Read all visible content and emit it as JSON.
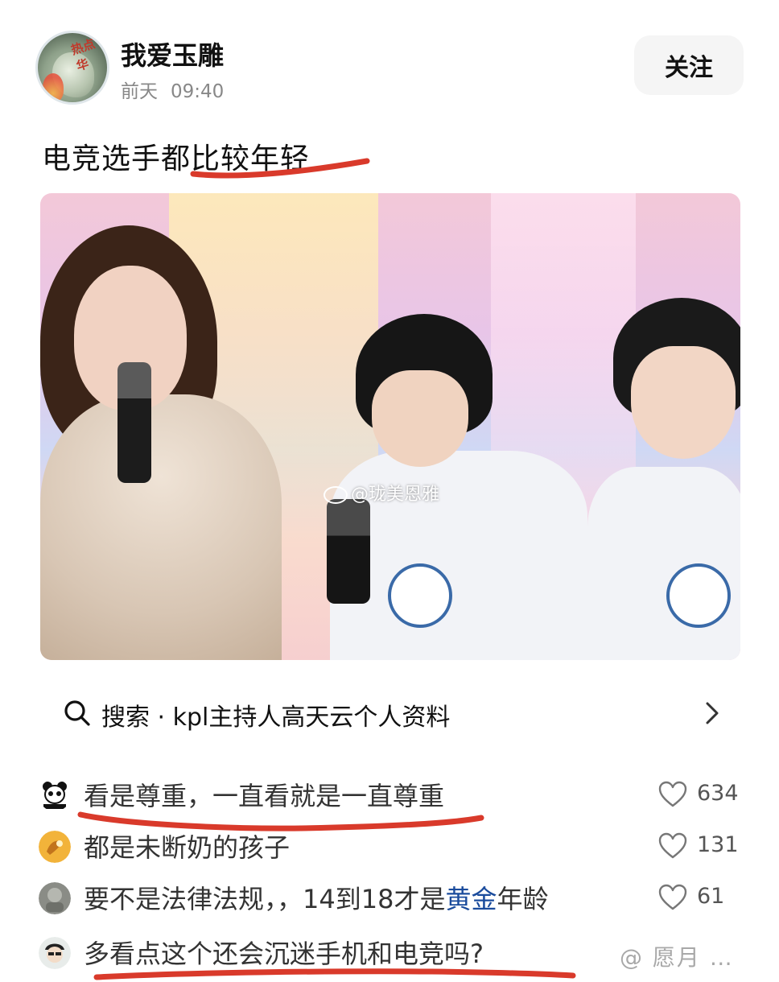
{
  "post": {
    "author": "我爱玉雕",
    "avatar_badge": "热点华",
    "time_day": "前天",
    "time_clock": "09:40",
    "follow_label": "关注",
    "title": "电竞选手都比较年轻",
    "photo_watermark": "@珑美恩雅"
  },
  "search": {
    "label": "搜索 · kpl主持人高天云个人资料",
    "icon": "search-icon",
    "chevron": "chevron-right-icon"
  },
  "comments": [
    {
      "text": "看是尊重，一直看就是一直尊重",
      "likes": "634"
    },
    {
      "text": "都是未断奶的孩子",
      "likes": "131"
    },
    {
      "text_before": "要不是法律法规，，14到18才是",
      "text_highlight": "黄金",
      "text_after": "年龄",
      "likes": "61"
    },
    {
      "text": "多看点这个还会沉迷手机和电竞吗?",
      "watermark": "@ 愿月 …"
    }
  ],
  "colors": {
    "accent_red": "#d93a2b",
    "highlight_blue": "#1a4b9c",
    "muted_gray": "#888888"
  }
}
